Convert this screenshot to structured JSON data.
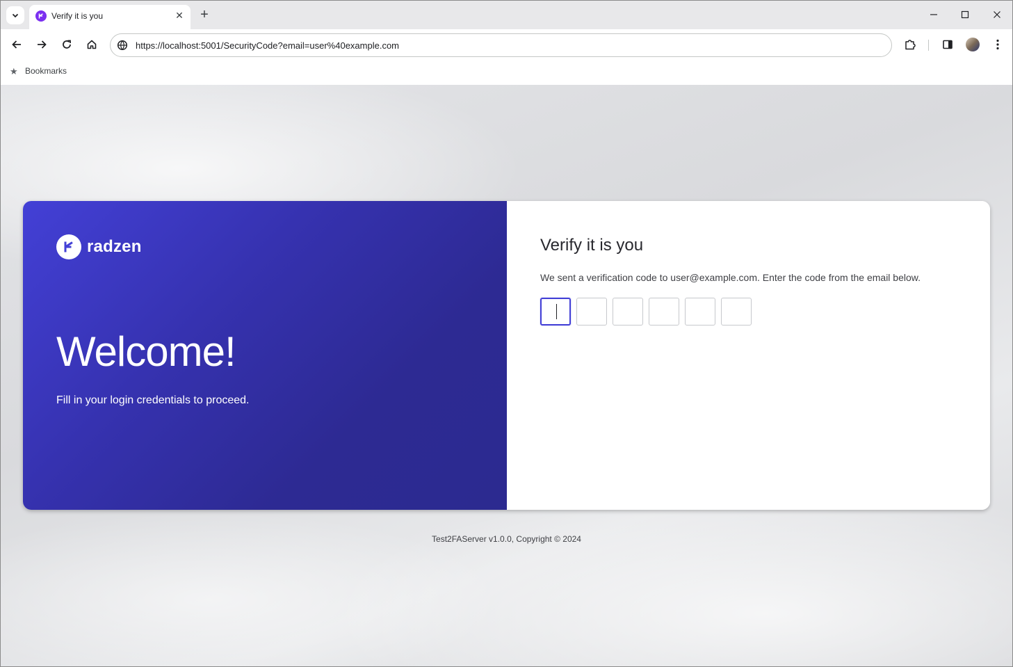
{
  "browser": {
    "tab_title": "Verify it is you",
    "url": "https://localhost:5001/SecurityCode?email=user%40example.com",
    "bookmarks_label": "Bookmarks",
    "new_tab_glyph": "+",
    "close_glyph": "✕"
  },
  "brand": {
    "name": "radzen",
    "accent": "#4340d6",
    "panel_gradient_start": "#4340d6",
    "panel_gradient_end": "#2c2a90"
  },
  "welcome_panel": {
    "heading": "Welcome!",
    "subtitle": "Fill in your login credentials to proceed."
  },
  "verify_panel": {
    "title": "Verify it is you",
    "description": "We sent a verification code to user@example.com. Enter the code from the email below.",
    "code_digits": [
      "",
      "",
      "",
      "",
      "",
      ""
    ]
  },
  "footer": {
    "text": "Test2FAServer v1.0.0, Copyright © 2024"
  },
  "icons": {
    "tab_search": "chevron-down-icon",
    "favicon": "radzen-logo-icon",
    "back": "arrow-left-icon",
    "forward": "arrow-right-icon",
    "reload": "reload-icon",
    "home": "home-icon",
    "site_info": "site-info-icon",
    "extensions": "puzzle-icon",
    "side_panel": "side-panel-icon",
    "menu": "kebab-menu-icon",
    "bookmark_star": "star-icon"
  }
}
